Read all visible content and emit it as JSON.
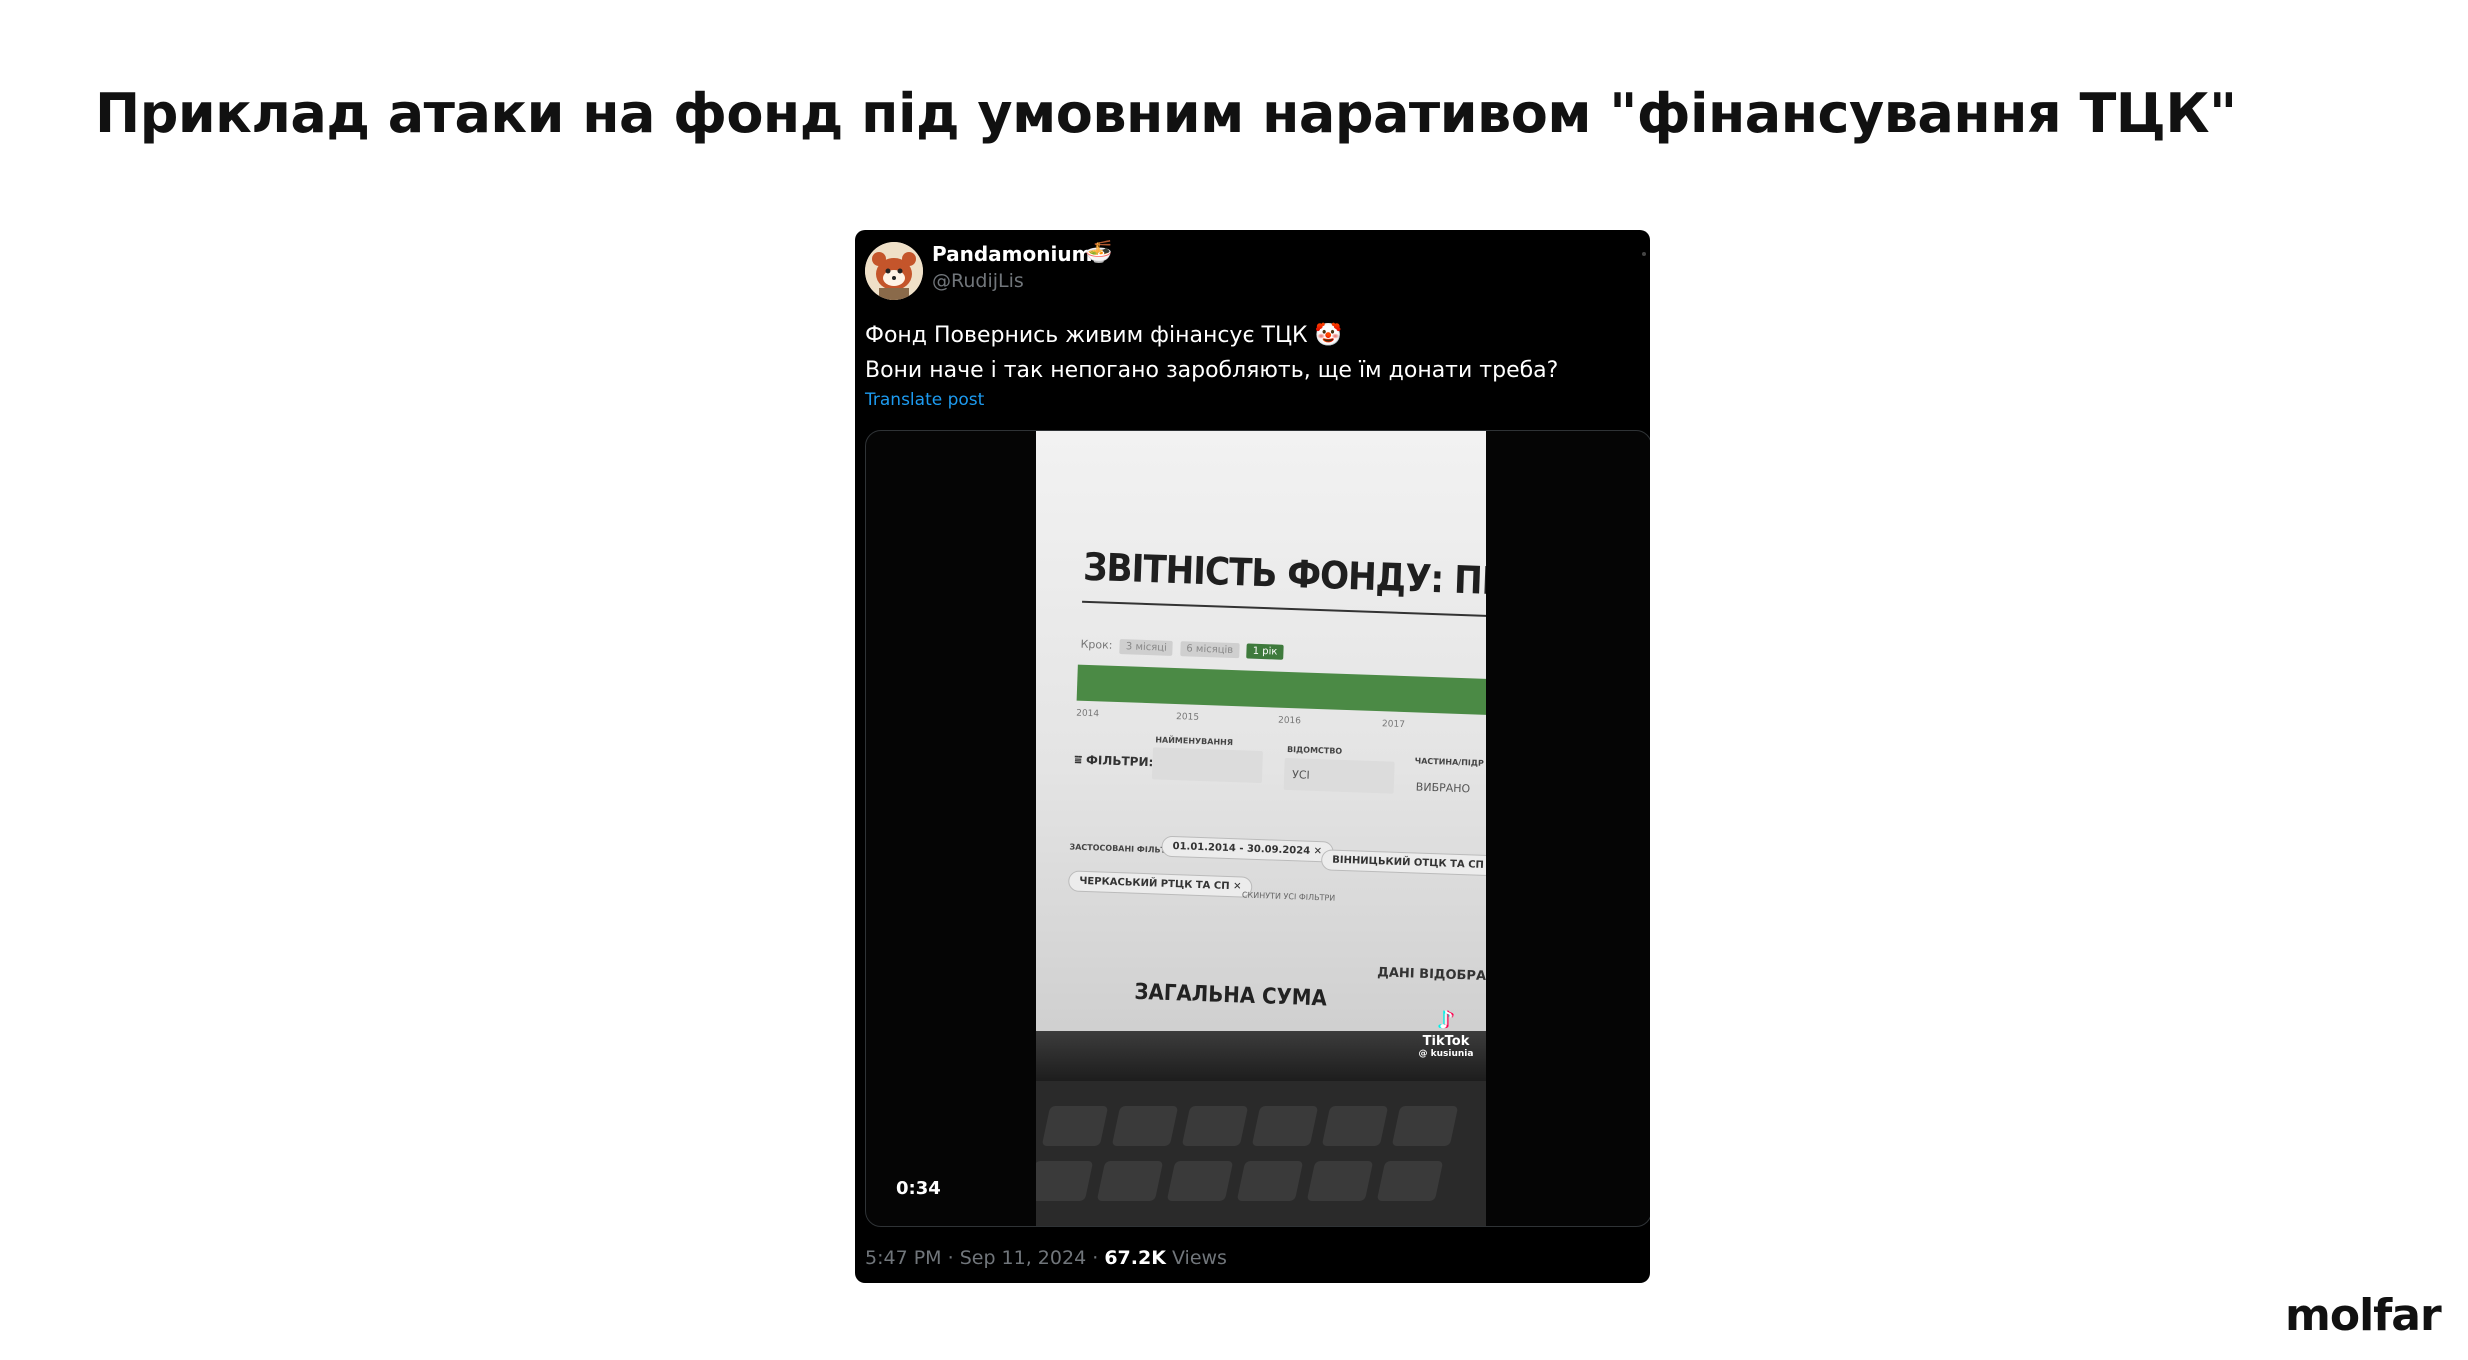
{
  "slide": {
    "title": "Приклад атаки на фонд під умовним наративом \"фінансування ТЦК\"",
    "logo_text": "molfar"
  },
  "tweet": {
    "display_name": "Pandamonium",
    "name_emoji": "🍜",
    "handle": "@RudijLis",
    "text_line_1": "Фонд Повернись живим фінансує ТЦК 🤡",
    "text_line_2": "Вони наче і так непогано заробляють, ще їм донати треба?",
    "translate_label": "Translate post",
    "video_duration": "0:34",
    "time": "5:47 PM",
    "date": "Sep 11, 2024",
    "views_count": "67.2K",
    "views_label": "Views",
    "separator": "·"
  },
  "video_frame": {
    "report_title": "ЗВІТНІСТЬ ФОНДУ: ПЕРЕДАЧІ",
    "step_label": "Крок:",
    "step_options": [
      "3 місяці",
      "6 місяців",
      "1 рік"
    ],
    "years": [
      "2014",
      "2015",
      "2016",
      "2017"
    ],
    "filters_label": "ФІЛЬТРИ:",
    "name_field_label": "НАЙМЕНУВАННЯ",
    "department_label": "ВІДОМСТВО",
    "department_value": "УСІ",
    "unit_label": "ЧАСТИНА/ПІДР",
    "unit_value": "ВИБРАНО",
    "applied_filters_label": "ЗАСТОСОВАНІ ФІЛЬТРИ:",
    "chip_dates": "01.01.2014 - 30.09.2024",
    "chip_vinnytsia": "ВІННИЦЬКИЙ ОТЦК ТА СП",
    "chip_cherkasy": "ЧЕРКАСЬКИЙ РТЦК ТА СП",
    "clear_all": "СКИНУТИ УСІ ФІЛЬТРИ",
    "data_shown": "ДАНІ ВІДОБРАЖ",
    "total_sum": "ЗАГАЛЬНА СУМА",
    "tiktok_label": "TikTok",
    "tiktok_handle": "@ kusiunia"
  },
  "colors": {
    "tweet_bg": "#000000",
    "link": "#1d9bf0",
    "muted": "#71767b",
    "report_green": "#4b8a45"
  }
}
